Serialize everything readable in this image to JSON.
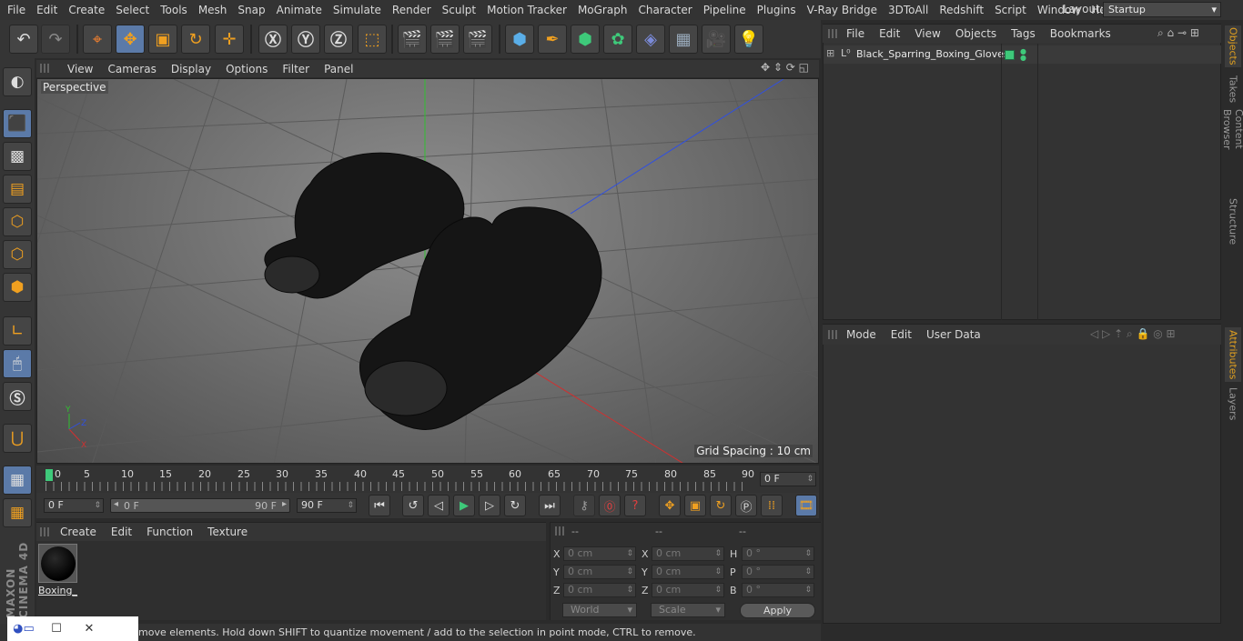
{
  "menubar": {
    "items": [
      "File",
      "Edit",
      "Create",
      "Select",
      "Tools",
      "Mesh",
      "Snap",
      "Animate",
      "Simulate",
      "Render",
      "Sculpt",
      "Motion Tracker",
      "MoGraph",
      "Character",
      "Pipeline",
      "Plugins",
      "V-Ray Bridge",
      "3DToAll",
      "Redshift",
      "Script",
      "Window",
      "Help"
    ],
    "layout_label": "Layout:",
    "layout_value": "Startup"
  },
  "viewport": {
    "menu": [
      "View",
      "Cameras",
      "Display",
      "Options",
      "Filter",
      "Panel"
    ],
    "camera_label": "Perspective",
    "grid_spacing": "Grid Spacing : 10 cm"
  },
  "timeline": {
    "ticks": [
      "0",
      "5",
      "10",
      "15",
      "20",
      "25",
      "30",
      "35",
      "40",
      "45",
      "50",
      "55",
      "60",
      "65",
      "70",
      "75",
      "80",
      "85",
      "90"
    ],
    "current_frame": "0 F",
    "start_frame": "0 F",
    "range_start": "0 F",
    "range_end": "90 F",
    "end_frame": "90 F"
  },
  "materials": {
    "menu": [
      "Create",
      "Edit",
      "Function",
      "Texture"
    ],
    "material_name": "Boxing_"
  },
  "coords": {
    "headers": [
      "--",
      "--",
      "--"
    ],
    "rows": [
      {
        "a_label": "X",
        "a_val": "0 cm",
        "b_label": "X",
        "b_val": "0 cm",
        "c_label": "H",
        "c_val": "0 °"
      },
      {
        "a_label": "Y",
        "a_val": "0 cm",
        "b_label": "Y",
        "b_val": "0 cm",
        "c_label": "P",
        "c_val": "0 °"
      },
      {
        "a_label": "Z",
        "a_val": "0 cm",
        "b_label": "Z",
        "b_val": "0 cm",
        "c_label": "B",
        "c_val": "0 °"
      }
    ],
    "space": "World",
    "mode": "Scale",
    "apply": "Apply"
  },
  "objects": {
    "menu": [
      "File",
      "Edit",
      "View",
      "Objects",
      "Tags",
      "Bookmarks"
    ],
    "object_name": "Black_Sparring_Boxing_Gloves",
    "tag_color": "#3ec97a"
  },
  "attributes": {
    "menu": [
      "Mode",
      "Edit",
      "User Data"
    ]
  },
  "sidetabs": [
    "Objects",
    "Takes",
    "Content Browser",
    "Structure",
    "Attributes",
    "Layers"
  ],
  "status": "move elements. Hold down SHIFT to quantize movement / add to the selection in point mode, CTRL to remove.",
  "brand": "MAXON CINEMA 4D",
  "colors": {
    "accent": "#5b7aa8",
    "axis_x": "#d03030",
    "axis_y": "#30c030",
    "axis_z": "#3050e0"
  }
}
